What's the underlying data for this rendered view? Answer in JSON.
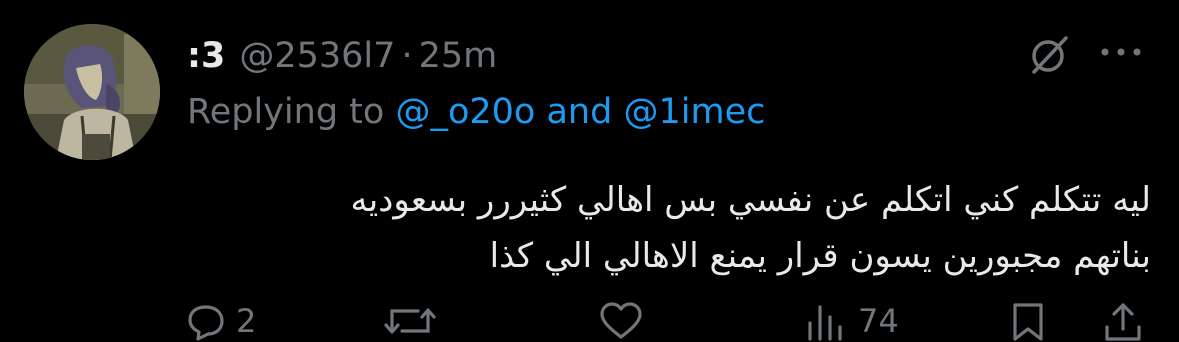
{
  "tweet": {
    "display_name": ":3",
    "handle": "@2536l7",
    "separator": "·",
    "time": "25m",
    "replying_prefix": "Replying to",
    "mention_1": "@_o20o",
    "mention_join": "and",
    "mention_2": "@1imec",
    "text_line1": "ليه تتكلم كني اتكلم عن نفسي بس اهالي كثيررر بسعوديه",
    "text_line2": "بناتهم مجبورين يسون قرار يمنع الاهالي الي كذا"
  },
  "actions": {
    "reply_count": "2",
    "views_count": "74"
  },
  "icons": {
    "grok": "grok-slash-icon",
    "more": "more-dots-icon",
    "reply": "reply-bubble-icon",
    "retweet": "retweet-icon",
    "like": "heart-icon",
    "views": "views-bars-icon",
    "bookmark": "bookmark-icon",
    "share": "share-icon"
  },
  "colors": {
    "background": "#000000",
    "text": "#e7e9ea",
    "muted": "#71767b",
    "link": "#1d9bf0"
  }
}
